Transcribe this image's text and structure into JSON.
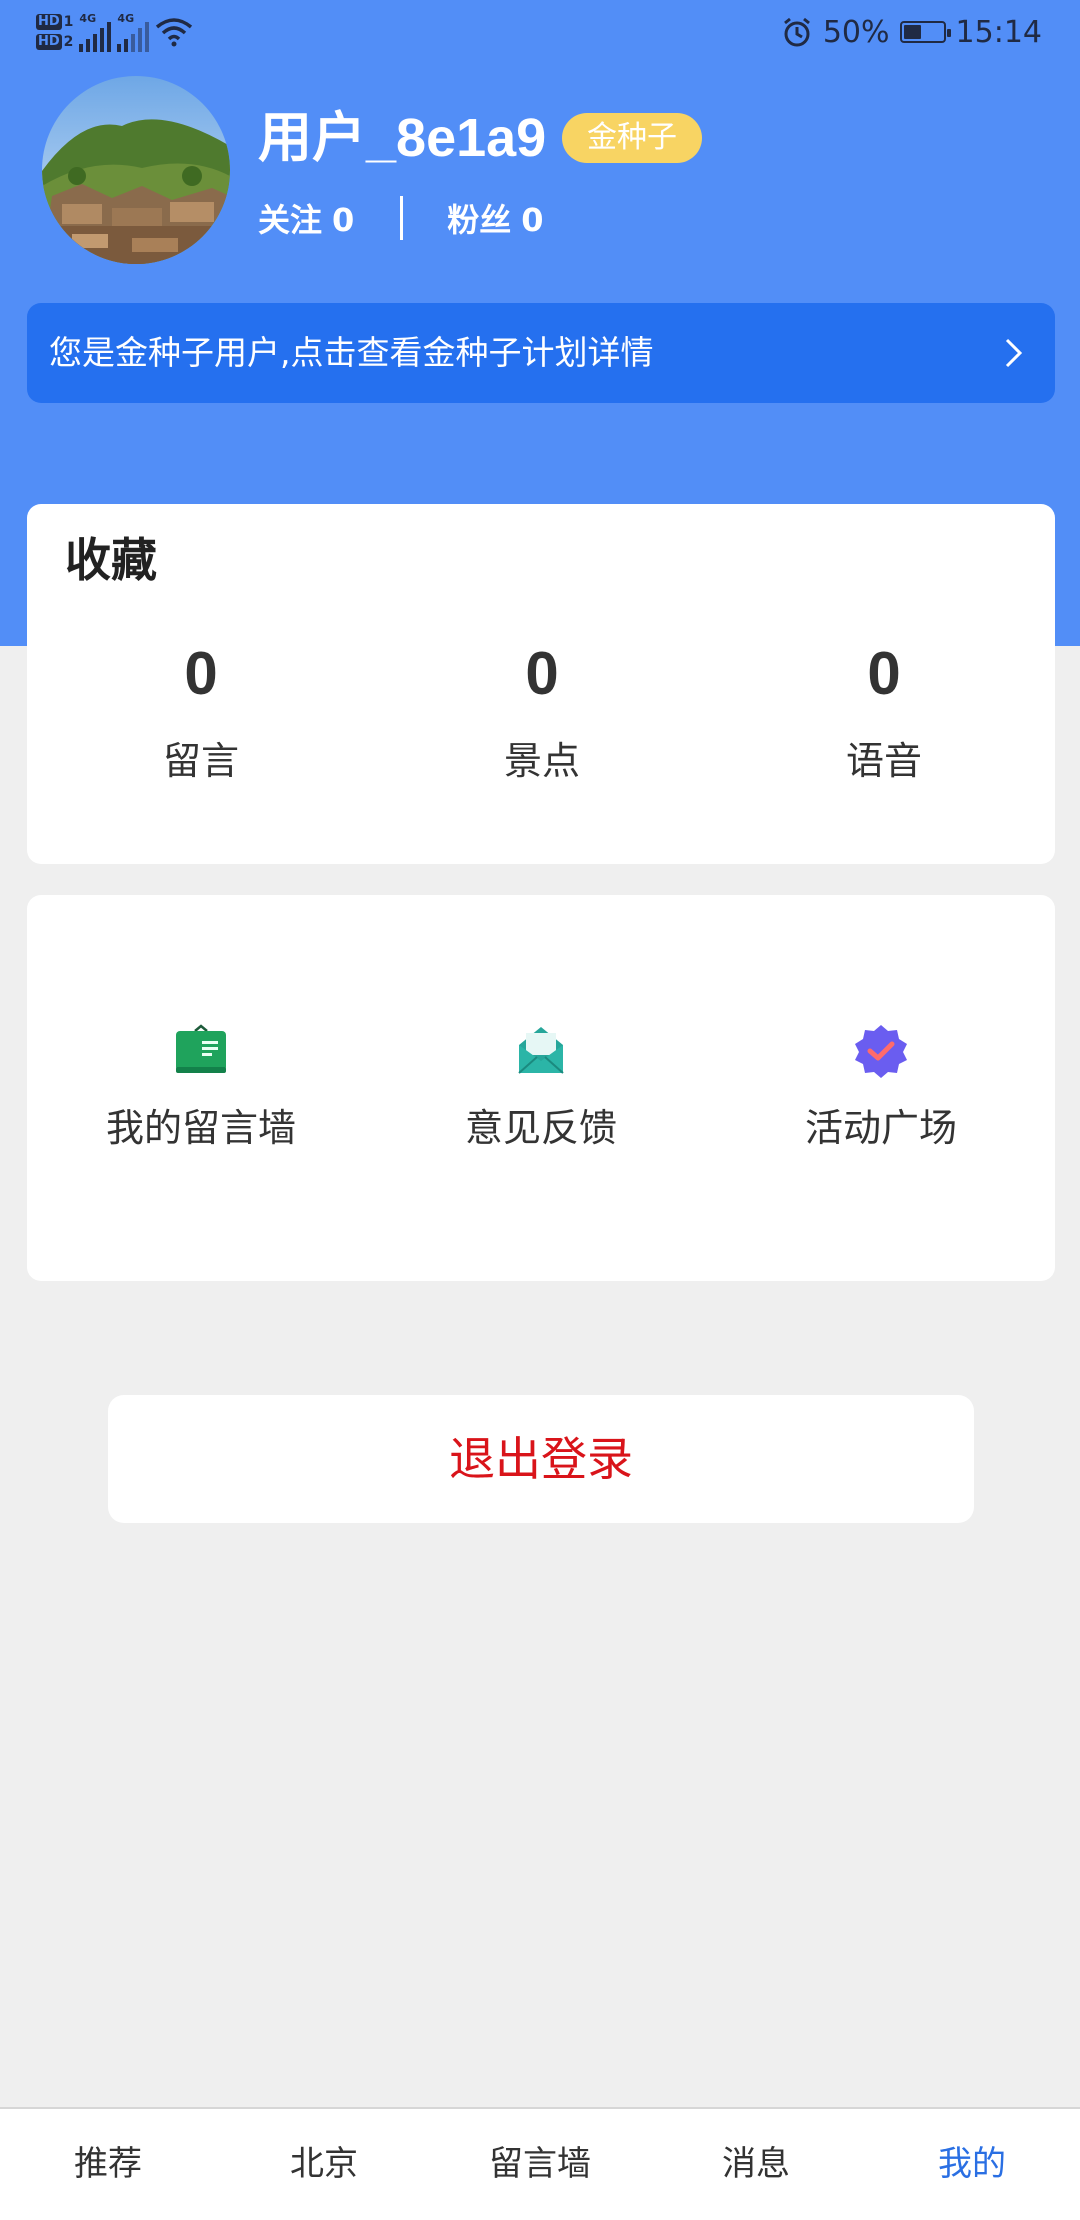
{
  "status_bar": {
    "hd1": "HD",
    "hd1_sub": "1",
    "hd2": "HD",
    "hd2_sub": "2",
    "net1": "4G",
    "net2": "4G",
    "battery_text": "50%",
    "battery_level": 0.5,
    "time": "15:14"
  },
  "profile": {
    "username": "用户_8e1a9",
    "badge": "金种子",
    "following_label": "关注",
    "following_count": "0",
    "followers_label": "粉丝",
    "followers_count": "0"
  },
  "banner": {
    "text": "您是金种子用户,点击查看金种子计划详情"
  },
  "favorites": {
    "title": "收藏",
    "items": [
      {
        "count": "0",
        "label": "留言"
      },
      {
        "count": "0",
        "label": "景点"
      },
      {
        "count": "0",
        "label": "语音"
      }
    ]
  },
  "menu": {
    "items": [
      {
        "label": "我的留言墙",
        "icon": "message-board-icon"
      },
      {
        "label": "意见反馈",
        "icon": "feedback-envelope-icon"
      },
      {
        "label": "活动广场",
        "icon": "activity-badge-icon"
      }
    ]
  },
  "logout_label": "退出登录",
  "tabs": [
    {
      "label": "推荐"
    },
    {
      "label": "北京"
    },
    {
      "label": "留言墙"
    },
    {
      "label": "消息"
    },
    {
      "label": "我的"
    }
  ],
  "colors": {
    "header": "#528ef7",
    "banner": "#2570ef",
    "badge": "#f8d463",
    "logout": "#d9141a",
    "tab_active": "#2a6fe3"
  }
}
